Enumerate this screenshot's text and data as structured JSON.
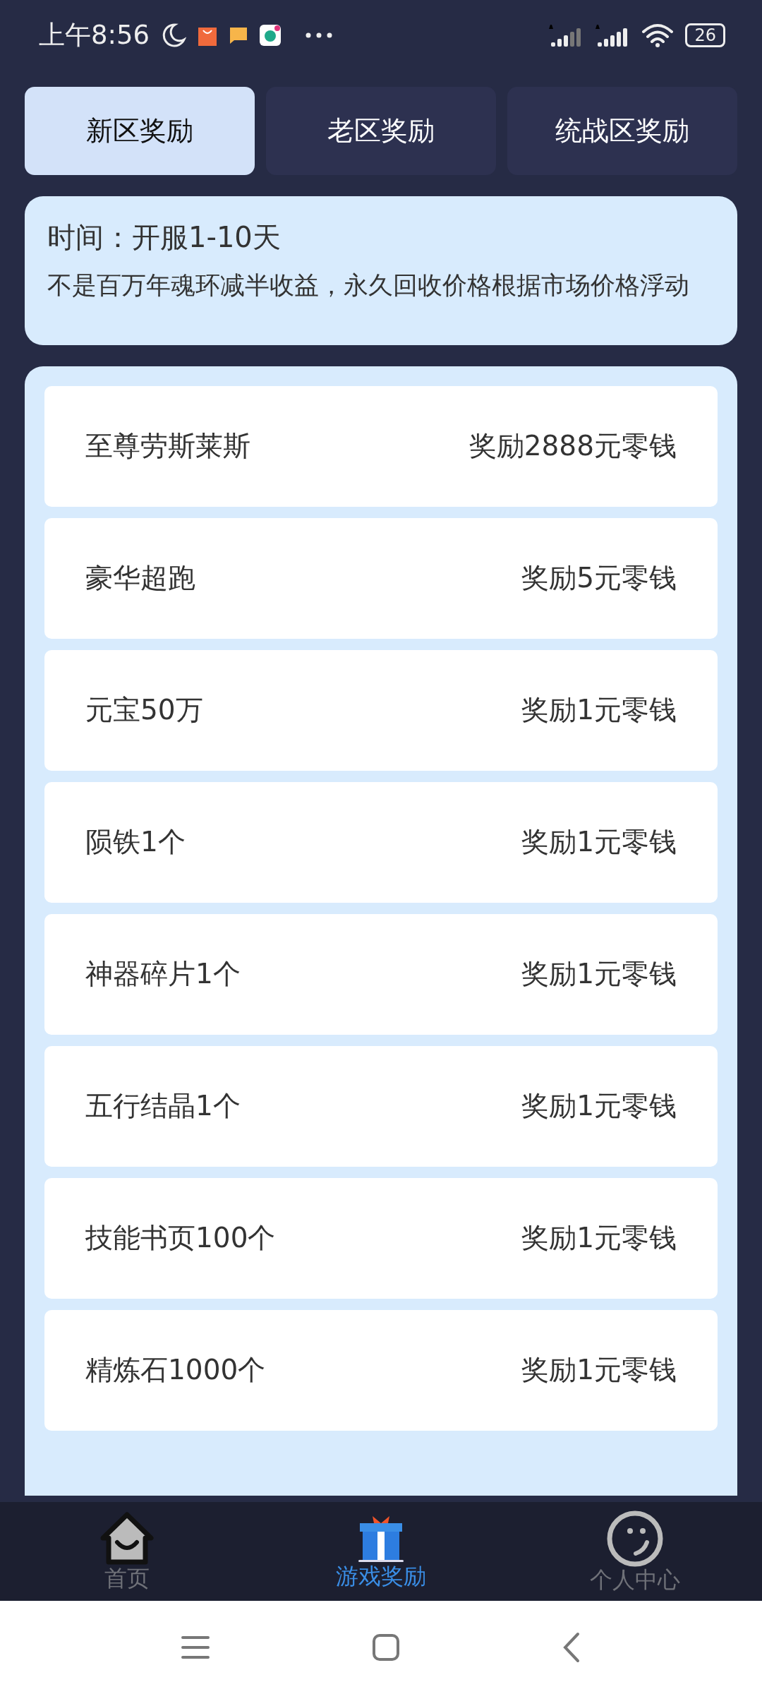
{
  "status_bar": {
    "time": "上午8:56",
    "battery": "26"
  },
  "tabs": [
    {
      "label": "新区奖励",
      "selected": true
    },
    {
      "label": "老区奖励",
      "selected": false
    },
    {
      "label": "统战区奖励",
      "selected": false
    }
  ],
  "info": {
    "title": "时间：开服1-10天",
    "text": "不是百万年魂环减半收益，永久回收价格根据市场价格浮动"
  },
  "rewards": [
    {
      "item": "至尊劳斯莱斯",
      "reward": "奖励2888元零钱"
    },
    {
      "item": "豪华超跑",
      "reward": "奖励5元零钱"
    },
    {
      "item": "元宝50万",
      "reward": "奖励1元零钱"
    },
    {
      "item": "陨铁1个",
      "reward": "奖励1元零钱"
    },
    {
      "item": "神器碎片1个",
      "reward": "奖励1元零钱"
    },
    {
      "item": "五行结晶1个",
      "reward": "奖励1元零钱"
    },
    {
      "item": "技能书页100个",
      "reward": "奖励1元零钱"
    },
    {
      "item": "精炼石1000个",
      "reward": "奖励1元零钱"
    }
  ],
  "bottom_nav": [
    {
      "kind": "home",
      "label": "首页",
      "selected": false
    },
    {
      "kind": "gift",
      "label": "游戏奖励",
      "selected": true
    },
    {
      "kind": "profile",
      "label": "个人中心",
      "selected": false
    }
  ]
}
